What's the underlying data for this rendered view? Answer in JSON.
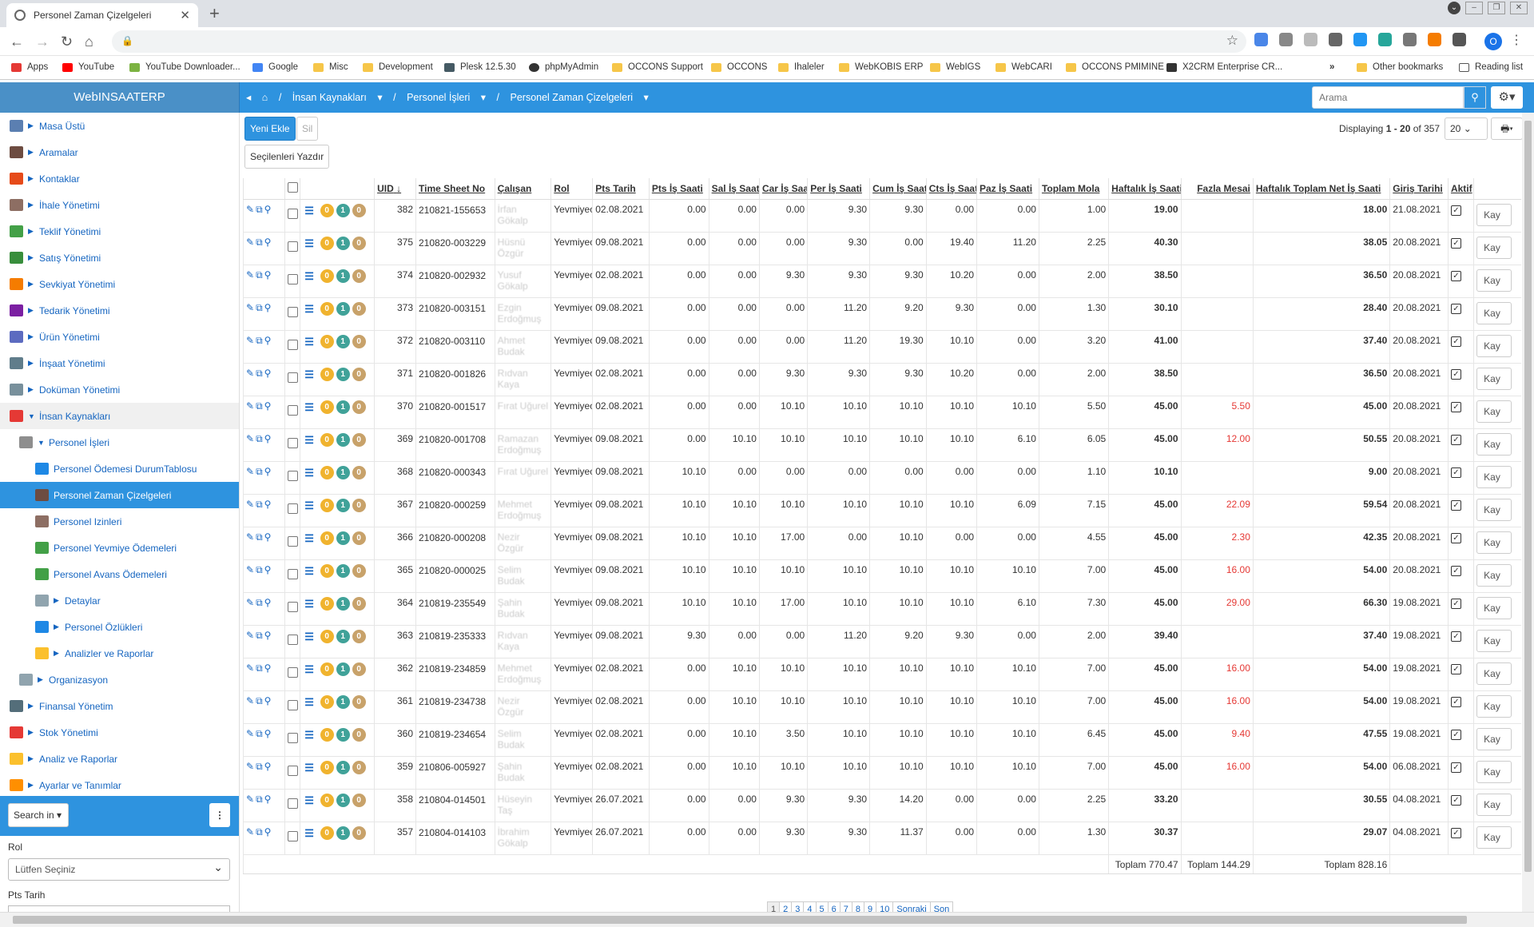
{
  "browser": {
    "tab_title": "Personel Zaman Çizelgeleri",
    "profile_letter": "O"
  },
  "bookmarks": [
    {
      "label": "Apps"
    },
    {
      "label": "YouTube"
    },
    {
      "label": "YouTube Downloader..."
    },
    {
      "label": "Google"
    },
    {
      "label": "Misc"
    },
    {
      "label": "Development"
    },
    {
      "label": "Plesk 12.5.30"
    },
    {
      "label": "phpMyAdmin"
    },
    {
      "label": "OCCONS Support"
    },
    {
      "label": "OCCONS"
    },
    {
      "label": "Ihaleler"
    },
    {
      "label": "WebKOBIS ERP"
    },
    {
      "label": "WebIGS"
    },
    {
      "label": "WebCARI"
    },
    {
      "label": "OCCONS PMIMINE"
    },
    {
      "label": "X2CRM Enterprise CR..."
    },
    {
      "label": "Other bookmarks"
    },
    {
      "label": "Reading list"
    }
  ],
  "bookmarks_more": "»",
  "app": {
    "brand": "WebINSAATERP",
    "search_placeholder": "Arama"
  },
  "breadcrumb": {
    "c1": "İnsan Kaynakları",
    "c2": "Personel İşleri",
    "c3": "Personel Zaman Çizelgeleri"
  },
  "sidebar": {
    "items": [
      {
        "label": "Masa Üstü"
      },
      {
        "label": "Aramalar"
      },
      {
        "label": "Kontaklar"
      },
      {
        "label": "İhale Yönetimi"
      },
      {
        "label": "Teklif Yönetimi"
      },
      {
        "label": "Satış Yönetimi"
      },
      {
        "label": "Sevkiyat Yönetimi"
      },
      {
        "label": "Tedarik Yönetimi"
      },
      {
        "label": "Ürün Yönetimi"
      },
      {
        "label": "İnşaat Yönetimi"
      },
      {
        "label": "Doküman Yönetimi"
      },
      {
        "label": "İnsan Kaynakları"
      },
      {
        "label": "Personel İşleri"
      },
      {
        "label": "Personel Ödemesi DurumTablosu"
      },
      {
        "label": "Personel Zaman Çizelgeleri"
      },
      {
        "label": "Personel Izinleri"
      },
      {
        "label": "Personel Yevmiye Ödemeleri"
      },
      {
        "label": "Personel Avans Ödemeleri"
      },
      {
        "label": "Detaylar"
      },
      {
        "label": "Personel Özlükleri"
      },
      {
        "label": "Analizler ve Raporlar"
      },
      {
        "label": "Organizasyon"
      },
      {
        "label": "Finansal Yönetim"
      },
      {
        "label": "Stok Yönetimi"
      },
      {
        "label": "Analiz ve Raporlar"
      },
      {
        "label": "Ayarlar ve Tanımlar"
      }
    ],
    "search_in": "Search in",
    "rol_label": "Rol",
    "rol_value": "Lütfen Seçiniz",
    "pts_label": "Pts Tarih"
  },
  "toolbar": {
    "add": "Yeni Ekle",
    "delete": "Sil",
    "print": "Seçilenleri Yazdır",
    "display_pre": "Displaying ",
    "display_range": "1 - 20",
    "display_post": " of 357",
    "per_page": "20"
  },
  "table": {
    "headers": [
      "UID",
      "Time Sheet No",
      "Çalışan",
      "Rol",
      "Pts Tarih",
      "Pts İş Saati",
      "Sal İş Saati",
      "Car İş Saati",
      "Per İş Saati",
      "Cum İş Saati",
      "Cts İş Saati",
      "Paz İş Saati",
      "Toplam Mola",
      "Haftalık İş Saati",
      "Fazla Mesai",
      "Haftalık Toplam Net İş Saati",
      "Giriş Tarihi",
      "Aktif"
    ],
    "badges": [
      "0",
      "1",
      "0"
    ],
    "save_label": "Kay",
    "rows": [
      {
        "uid": "382",
        "ts": "210821-155653",
        "emp": "İrfan Gökalp",
        "rol": "Yevmiyeci",
        "date": "02.08.2021",
        "pts": "0.00",
        "sal": "0.00",
        "car": "0.00",
        "per": "9.30",
        "cum": "9.30",
        "cts": "0.00",
        "paz": "0.00",
        "mola": "1.00",
        "haft": "19.00",
        "fazla": "",
        "net": "18.00",
        "giris": "21.08.2021"
      },
      {
        "uid": "375",
        "ts": "210820-003229",
        "emp": "Hüsnü Özgür",
        "rol": "Yevmiyeci",
        "date": "09.08.2021",
        "pts": "0.00",
        "sal": "0.00",
        "car": "0.00",
        "per": "9.30",
        "cum": "0.00",
        "cts": "19.40",
        "paz": "11.20",
        "mola": "2.25",
        "haft": "40.30",
        "fazla": "",
        "net": "38.05",
        "giris": "20.08.2021"
      },
      {
        "uid": "374",
        "ts": "210820-002932",
        "emp": "Yusuf Gökalp",
        "rol": "Yevmiyeci",
        "date": "02.08.2021",
        "pts": "0.00",
        "sal": "0.00",
        "car": "9.30",
        "per": "9.30",
        "cum": "9.30",
        "cts": "10.20",
        "paz": "0.00",
        "mola": "2.00",
        "haft": "38.50",
        "fazla": "",
        "net": "36.50",
        "giris": "20.08.2021"
      },
      {
        "uid": "373",
        "ts": "210820-003151",
        "emp": "Ezgin Erdoğmuş",
        "rol": "Yevmiyeci",
        "date": "09.08.2021",
        "pts": "0.00",
        "sal": "0.00",
        "car": "0.00",
        "per": "11.20",
        "cum": "9.20",
        "cts": "9.30",
        "paz": "0.00",
        "mola": "1.30",
        "haft": "30.10",
        "fazla": "",
        "net": "28.40",
        "giris": "20.08.2021"
      },
      {
        "uid": "372",
        "ts": "210820-003110",
        "emp": "Ahmet Budak",
        "rol": "Yevmiyeci",
        "date": "09.08.2021",
        "pts": "0.00",
        "sal": "0.00",
        "car": "0.00",
        "per": "11.20",
        "cum": "19.30",
        "cts": "10.10",
        "paz": "0.00",
        "mola": "3.20",
        "haft": "41.00",
        "fazla": "",
        "net": "37.40",
        "giris": "20.08.2021"
      },
      {
        "uid": "371",
        "ts": "210820-001826",
        "emp": "Rıdvan Kaya",
        "rol": "Yevmiyeci",
        "date": "02.08.2021",
        "pts": "0.00",
        "sal": "0.00",
        "car": "9.30",
        "per": "9.30",
        "cum": "9.30",
        "cts": "10.20",
        "paz": "0.00",
        "mola": "2.00",
        "haft": "38.50",
        "fazla": "",
        "net": "36.50",
        "giris": "20.08.2021"
      },
      {
        "uid": "370",
        "ts": "210820-001517",
        "emp": "Fırat Uğurel",
        "rol": "Yevmiyeci",
        "date": "02.08.2021",
        "pts": "0.00",
        "sal": "0.00",
        "car": "10.10",
        "per": "10.10",
        "cum": "10.10",
        "cts": "10.10",
        "paz": "10.10",
        "mola": "5.50",
        "haft": "45.00",
        "fazla": "5.50",
        "net": "45.00",
        "giris": "20.08.2021"
      },
      {
        "uid": "369",
        "ts": "210820-001708",
        "emp": "Ramazan Erdoğmuş",
        "rol": "Yevmiyeci",
        "date": "09.08.2021",
        "pts": "0.00",
        "sal": "10.10",
        "car": "10.10",
        "per": "10.10",
        "cum": "10.10",
        "cts": "10.10",
        "paz": "6.10",
        "mola": "6.05",
        "haft": "45.00",
        "fazla": "12.00",
        "net": "50.55",
        "giris": "20.08.2021"
      },
      {
        "uid": "368",
        "ts": "210820-000343",
        "emp": "Fırat Uğurel",
        "rol": "Yevmiyeci",
        "date": "09.08.2021",
        "pts": "10.10",
        "sal": "0.00",
        "car": "0.00",
        "per": "0.00",
        "cum": "0.00",
        "cts": "0.00",
        "paz": "0.00",
        "mola": "1.10",
        "haft": "10.10",
        "fazla": "",
        "net": "9.00",
        "giris": "20.08.2021"
      },
      {
        "uid": "367",
        "ts": "210820-000259",
        "emp": "Mehmet Erdoğmuş",
        "rol": "Yevmiyeci",
        "date": "09.08.2021",
        "pts": "10.10",
        "sal": "10.10",
        "car": "10.10",
        "per": "10.10",
        "cum": "10.10",
        "cts": "10.10",
        "paz": "6.09",
        "mola": "7.15",
        "haft": "45.00",
        "fazla": "22.09",
        "net": "59.54",
        "giris": "20.08.2021"
      },
      {
        "uid": "366",
        "ts": "210820-000208",
        "emp": "Nezir Özgür",
        "rol": "Yevmiyeci",
        "date": "09.08.2021",
        "pts": "10.10",
        "sal": "10.10",
        "car": "17.00",
        "per": "0.00",
        "cum": "10.10",
        "cts": "0.00",
        "paz": "0.00",
        "mola": "4.55",
        "haft": "45.00",
        "fazla": "2.30",
        "net": "42.35",
        "giris": "20.08.2021"
      },
      {
        "uid": "365",
        "ts": "210820-000025",
        "emp": "Selim Budak",
        "rol": "Yevmiyeci",
        "date": "09.08.2021",
        "pts": "10.10",
        "sal": "10.10",
        "car": "10.10",
        "per": "10.10",
        "cum": "10.10",
        "cts": "10.10",
        "paz": "10.10",
        "mola": "7.00",
        "haft": "45.00",
        "fazla": "16.00",
        "net": "54.00",
        "giris": "20.08.2021"
      },
      {
        "uid": "364",
        "ts": "210819-235549",
        "emp": "Şahin Budak",
        "rol": "Yevmiyeci",
        "date": "09.08.2021",
        "pts": "10.10",
        "sal": "10.10",
        "car": "17.00",
        "per": "10.10",
        "cum": "10.10",
        "cts": "10.10",
        "paz": "6.10",
        "mola": "7.30",
        "haft": "45.00",
        "fazla": "29.00",
        "net": "66.30",
        "giris": "19.08.2021"
      },
      {
        "uid": "363",
        "ts": "210819-235333",
        "emp": "Rıdvan Kaya",
        "rol": "Yevmiyeci",
        "date": "09.08.2021",
        "pts": "9.30",
        "sal": "0.00",
        "car": "0.00",
        "per": "11.20",
        "cum": "9.20",
        "cts": "9.30",
        "paz": "0.00",
        "mola": "2.00",
        "haft": "39.40",
        "fazla": "",
        "net": "37.40",
        "giris": "19.08.2021"
      },
      {
        "uid": "362",
        "ts": "210819-234859",
        "emp": "Mehmet Erdoğmuş",
        "rol": "Yevmiyeci",
        "date": "02.08.2021",
        "pts": "0.00",
        "sal": "10.10",
        "car": "10.10",
        "per": "10.10",
        "cum": "10.10",
        "cts": "10.10",
        "paz": "10.10",
        "mola": "7.00",
        "haft": "45.00",
        "fazla": "16.00",
        "net": "54.00",
        "giris": "19.08.2021"
      },
      {
        "uid": "361",
        "ts": "210819-234738",
        "emp": "Nezir Özgür",
        "rol": "Yevmiyeci",
        "date": "02.08.2021",
        "pts": "0.00",
        "sal": "10.10",
        "car": "10.10",
        "per": "10.10",
        "cum": "10.10",
        "cts": "10.10",
        "paz": "10.10",
        "mola": "7.00",
        "haft": "45.00",
        "fazla": "16.00",
        "net": "54.00",
        "giris": "19.08.2021"
      },
      {
        "uid": "360",
        "ts": "210819-234654",
        "emp": "Selim Budak",
        "rol": "Yevmiyeci",
        "date": "02.08.2021",
        "pts": "0.00",
        "sal": "10.10",
        "car": "3.50",
        "per": "10.10",
        "cum": "10.10",
        "cts": "10.10",
        "paz": "10.10",
        "mola": "6.45",
        "haft": "45.00",
        "fazla": "9.40",
        "net": "47.55",
        "giris": "19.08.2021"
      },
      {
        "uid": "359",
        "ts": "210806-005927",
        "emp": "Şahin Budak",
        "rol": "Yevmiyeci",
        "date": "02.08.2021",
        "pts": "0.00",
        "sal": "10.10",
        "car": "10.10",
        "per": "10.10",
        "cum": "10.10",
        "cts": "10.10",
        "paz": "10.10",
        "mola": "7.00",
        "haft": "45.00",
        "fazla": "16.00",
        "net": "54.00",
        "giris": "06.08.2021"
      },
      {
        "uid": "358",
        "ts": "210804-014501",
        "emp": "Hüseyin Taş",
        "rol": "Yevmiyeci",
        "date": "26.07.2021",
        "pts": "0.00",
        "sal": "0.00",
        "car": "9.30",
        "per": "9.30",
        "cum": "14.20",
        "cts": "0.00",
        "paz": "0.00",
        "mola": "2.25",
        "haft": "33.20",
        "fazla": "",
        "net": "30.55",
        "giris": "04.08.2021"
      },
      {
        "uid": "357",
        "ts": "210804-014103",
        "emp": "İbrahim Gökalp",
        "rol": "Yevmiyeci",
        "date": "26.07.2021",
        "pts": "0.00",
        "sal": "0.00",
        "car": "9.30",
        "per": "9.30",
        "cum": "11.37",
        "cts": "0.00",
        "paz": "0.00",
        "mola": "1.30",
        "haft": "30.37",
        "fazla": "",
        "net": "29.07",
        "giris": "04.08.2021"
      }
    ],
    "totals": {
      "haft": "Toplam 770.47",
      "fazla": "Toplam 144.29",
      "net": "Toplam 828.16"
    }
  },
  "pager": [
    "1",
    "2",
    "3",
    "4",
    "5",
    "6",
    "7",
    "8",
    "9",
    "10",
    "Sonraki",
    "Son"
  ],
  "colors": {
    "accent": "#2e93df",
    "overtime": "#e53935",
    "link": "#1565c0"
  }
}
